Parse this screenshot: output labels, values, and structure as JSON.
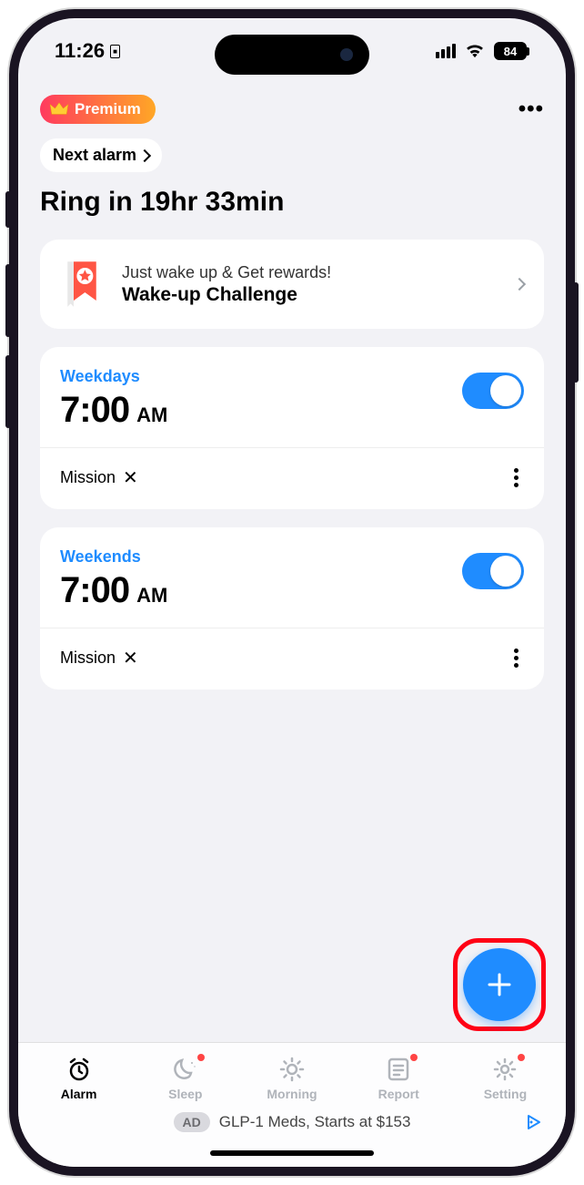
{
  "status": {
    "time": "11:26",
    "battery": "84"
  },
  "header": {
    "premium": "Premium",
    "next_alarm": "Next alarm",
    "headline": "Ring in 19hr 33min"
  },
  "challenge": {
    "subtitle": "Just wake up & Get rewards!",
    "title": "Wake-up Challenge"
  },
  "alarms": [
    {
      "tag": "Weekdays",
      "time": "7:00",
      "period": "AM",
      "mission_label": "Mission",
      "enabled": true
    },
    {
      "tag": "Weekends",
      "time": "7:00",
      "period": "AM",
      "mission_label": "Mission",
      "enabled": true
    }
  ],
  "tabs": [
    {
      "label": "Alarm"
    },
    {
      "label": "Sleep"
    },
    {
      "label": "Morning"
    },
    {
      "label": "Report"
    },
    {
      "label": "Setting"
    }
  ],
  "ad": {
    "badge": "AD",
    "text": "GLP-1 Meds, Starts at $153"
  }
}
